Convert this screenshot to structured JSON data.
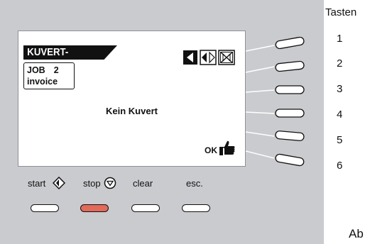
{
  "display": {
    "title": "KUVERT-EINGABEN",
    "job_label": "JOB",
    "job_number": "2",
    "job_name": "invoice",
    "message": "Kein Kuvert",
    "ok_label": "OK"
  },
  "controls": {
    "start_label": "start",
    "stop_label": "stop",
    "clear_label": "clear",
    "esc_label": "esc.",
    "stop_color": "#e26a5a"
  },
  "legend": {
    "title": "Tasten",
    "keys": [
      "1",
      "2",
      "3",
      "4",
      "5",
      "6"
    ],
    "footer": "Ab"
  },
  "icons": {
    "nav": [
      "arrow-left-icon",
      "arrow-both-icon",
      "cross-box-icon"
    ],
    "ok": "thumbs-up-icon",
    "start": "start-diamond-icon",
    "stop": "stop-circle-icon"
  }
}
